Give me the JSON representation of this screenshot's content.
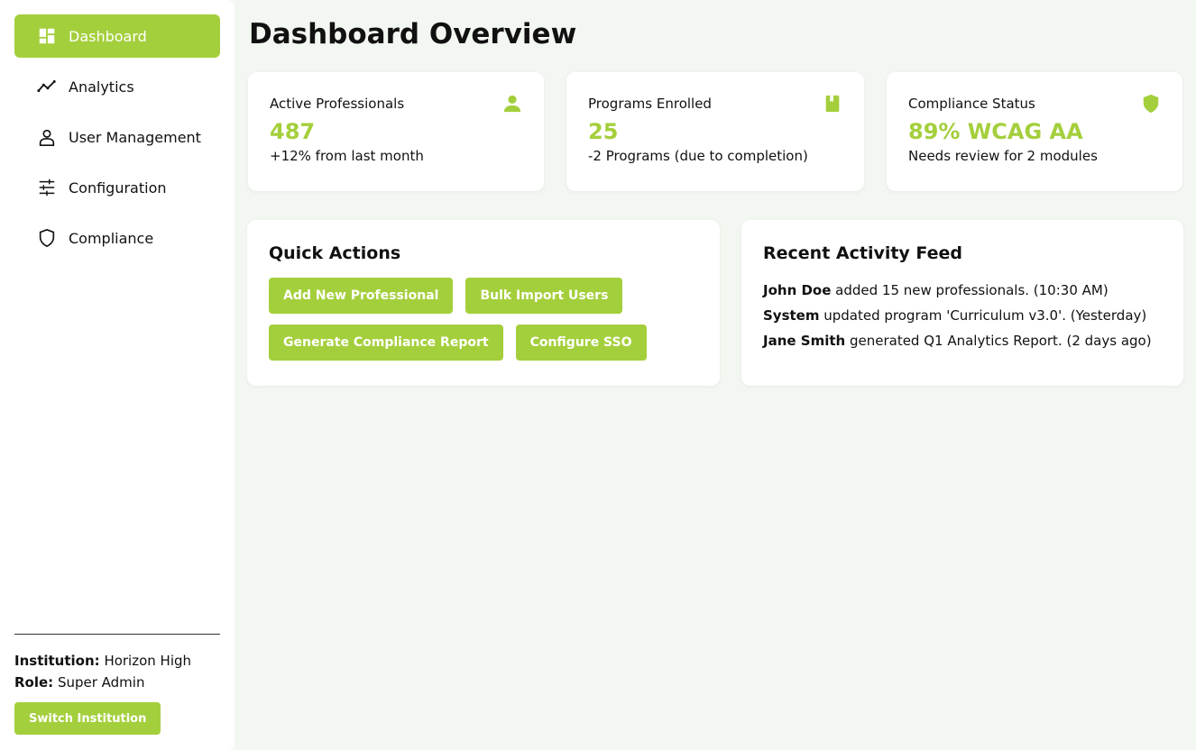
{
  "sidebar": {
    "items": [
      {
        "label": "Dashboard",
        "icon": "dashboard-icon",
        "active": true
      },
      {
        "label": "Analytics",
        "icon": "trending-icon"
      },
      {
        "label": "User Management",
        "icon": "user-icon"
      },
      {
        "label": "Configuration",
        "icon": "sliders-icon"
      },
      {
        "label": "Compliance",
        "icon": "shield-icon"
      }
    ],
    "institution_label": "Institution:",
    "institution_value": "Horizon High",
    "role_label": "Role:",
    "role_value": "Super Admin",
    "switch_label": "Switch Institution"
  },
  "page": {
    "title": "Dashboard Overview"
  },
  "stats": [
    {
      "label": "Active Professionals",
      "value": "487",
      "sub": "+12% from last month",
      "icon": "person-icon"
    },
    {
      "label": "Programs Enrolled",
      "value": "25",
      "sub": "-2 Programs (due to completion)",
      "icon": "book-icon"
    },
    {
      "label": "Compliance Status",
      "value": "89% WCAG AA",
      "sub": "Needs review for 2 modules",
      "icon": "shield-icon"
    }
  ],
  "quick_actions": {
    "title": "Quick Actions",
    "buttons": [
      "Add New Professional",
      "Bulk Import Users",
      "Generate Compliance Report",
      "Configure SSO"
    ]
  },
  "activity": {
    "title": "Recent Activity Feed",
    "items": [
      {
        "actor": "John Doe",
        "text": " added 15 new professionals. (10:30 AM)"
      },
      {
        "actor": "System",
        "text": " updated program 'Curriculum v3.0'. (Yesterday)"
      },
      {
        "actor": "Jane Smith",
        "text": " generated Q1 Analytics Report. (2 days ago)"
      }
    ]
  },
  "colors": {
    "accent": "#a4cf3c",
    "background": "#f3f7f1"
  }
}
